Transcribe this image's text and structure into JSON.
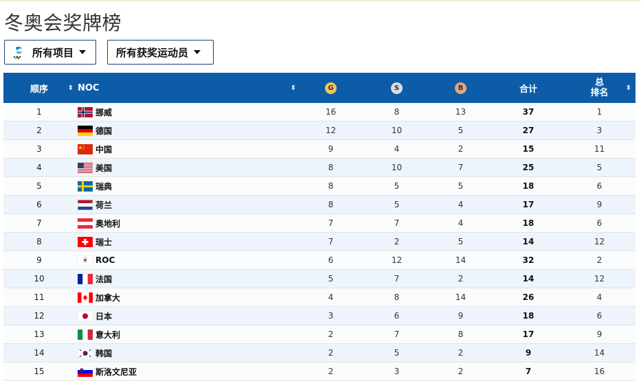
{
  "title": "冬奥会奖牌榜",
  "filters": {
    "events_label": "所有项目",
    "athletes_label": "所有获奖运动员"
  },
  "header": {
    "order": "顺序",
    "noc": "NOC",
    "gold": "G",
    "silver": "S",
    "bronze": "B",
    "total": "合计",
    "rank_line1": "总",
    "rank_line2": "排名"
  },
  "colors": {
    "header_bg": "#0d5ca8",
    "gold": "#f2c45c",
    "silver": "#d9dde3",
    "bronze": "#e2a77a"
  },
  "rows": [
    {
      "order": "1",
      "flag": "norway",
      "country": "挪威",
      "gold": "16",
      "silver": "8",
      "bronze": "13",
      "total": "37",
      "rank": "1"
    },
    {
      "order": "2",
      "flag": "germany",
      "country": "德国",
      "gold": "12",
      "silver": "10",
      "bronze": "5",
      "total": "27",
      "rank": "3"
    },
    {
      "order": "3",
      "flag": "china",
      "country": "中国",
      "gold": "9",
      "silver": "4",
      "bronze": "2",
      "total": "15",
      "rank": "11"
    },
    {
      "order": "4",
      "flag": "usa",
      "country": "美国",
      "gold": "8",
      "silver": "10",
      "bronze": "7",
      "total": "25",
      "rank": "5"
    },
    {
      "order": "5",
      "flag": "sweden",
      "country": "瑞典",
      "gold": "8",
      "silver": "5",
      "bronze": "5",
      "total": "18",
      "rank": "6"
    },
    {
      "order": "6",
      "flag": "netherlands",
      "country": "荷兰",
      "gold": "8",
      "silver": "5",
      "bronze": "4",
      "total": "17",
      "rank": "9"
    },
    {
      "order": "7",
      "flag": "austria",
      "country": "奥地利",
      "gold": "7",
      "silver": "7",
      "bronze": "4",
      "total": "18",
      "rank": "6"
    },
    {
      "order": "8",
      "flag": "switzerland",
      "country": "瑞士",
      "gold": "7",
      "silver": "2",
      "bronze": "5",
      "total": "14",
      "rank": "12"
    },
    {
      "order": "9",
      "flag": "roc",
      "country": "ROC",
      "gold": "6",
      "silver": "12",
      "bronze": "14",
      "total": "32",
      "rank": "2"
    },
    {
      "order": "10",
      "flag": "france",
      "country": "法国",
      "gold": "5",
      "silver": "7",
      "bronze": "2",
      "total": "14",
      "rank": "12"
    },
    {
      "order": "11",
      "flag": "canada",
      "country": "加拿大",
      "gold": "4",
      "silver": "8",
      "bronze": "14",
      "total": "26",
      "rank": "4"
    },
    {
      "order": "12",
      "flag": "japan",
      "country": "日本",
      "gold": "3",
      "silver": "6",
      "bronze": "9",
      "total": "18",
      "rank": "6"
    },
    {
      "order": "13",
      "flag": "italy",
      "country": "意大利",
      "gold": "2",
      "silver": "7",
      "bronze": "8",
      "total": "17",
      "rank": "9"
    },
    {
      "order": "14",
      "flag": "korea",
      "country": "韩国",
      "gold": "2",
      "silver": "5",
      "bronze": "2",
      "total": "9",
      "rank": "14"
    },
    {
      "order": "15",
      "flag": "slovenia",
      "country": "斯洛文尼亚",
      "gold": "2",
      "silver": "3",
      "bronze": "2",
      "total": "7",
      "rank": "16"
    }
  ]
}
